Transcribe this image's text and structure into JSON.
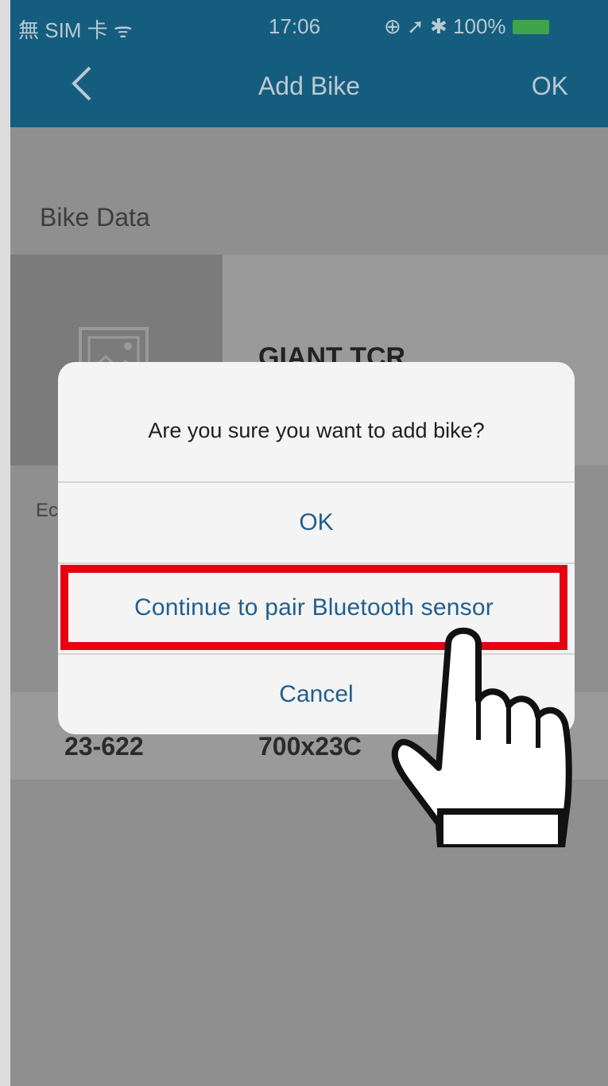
{
  "status_bar": {
    "carrier": "無 SIM 卡 ᯤ",
    "time": "17:06",
    "right": "⊕ ➚ ✱ 100%"
  },
  "nav": {
    "title": "Add Bike",
    "ok": "OK",
    "back_icon": "chevron-left-icon"
  },
  "background": {
    "section_title": "Bike Data",
    "bike_name": "GIANT TCR",
    "edit_label": "Ec",
    "spec_values": [
      "23-622",
      "700x23C"
    ],
    "photo_icon": "image-placeholder-icon"
  },
  "dialog": {
    "message": "Are you sure you want to add bike?",
    "ok": "OK",
    "pair": "Continue to pair Bluetooth sensor",
    "cancel": "Cancel"
  },
  "annotation": {
    "highlight_color": "#e60012",
    "pointer_icon": "hand-pointer-icon"
  },
  "colors": {
    "nav_bar": "#155d7f",
    "dialog_button_text": "#215f8d"
  }
}
